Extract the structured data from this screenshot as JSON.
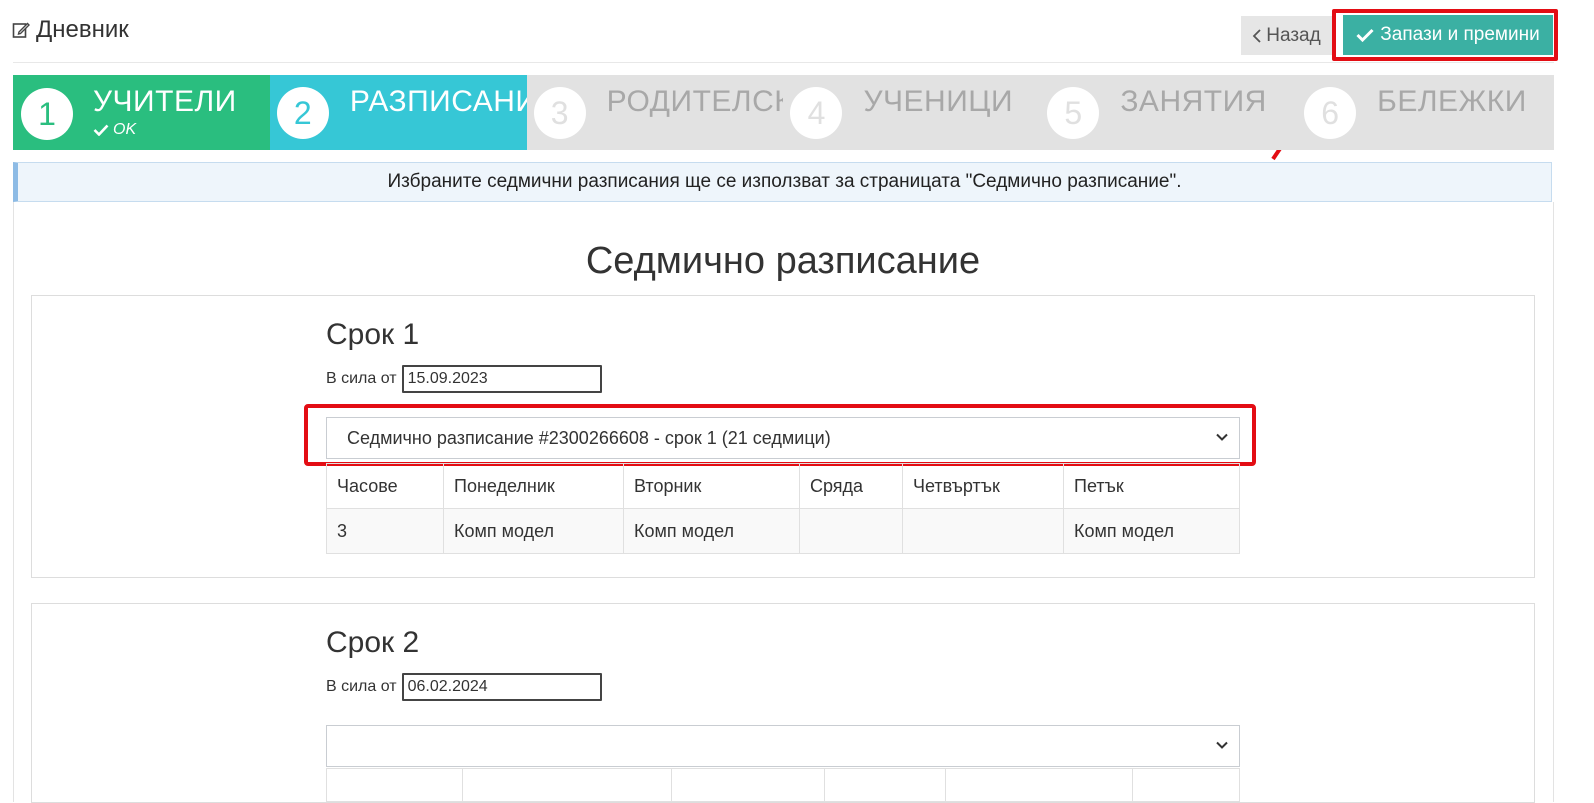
{
  "header": {
    "title": "Дневник",
    "back_label": "Назад",
    "save_label": "Запази и премини"
  },
  "steps": [
    {
      "number": "1",
      "label": "УЧИТЕЛИ",
      "sub": "OK",
      "state": "done"
    },
    {
      "number": "2",
      "label": "РАЗПИСАНИЯ",
      "state": "active"
    },
    {
      "number": "3",
      "label": "РОДИТЕЛСКИ",
      "state": "pending"
    },
    {
      "number": "4",
      "label": "УЧЕНИЦИ",
      "state": "pending"
    },
    {
      "number": "5",
      "label": "ЗАНЯТИЯ",
      "state": "pending"
    },
    {
      "number": "6",
      "label": "БЕЛЕЖКИ",
      "state": "pending"
    }
  ],
  "notice": "Избраните седмични разписания ще се използват за страницата \"Седмично разписание\".",
  "main_title": "Седмично разписание",
  "terms": [
    {
      "title": "Срок 1",
      "from_label": "В сила от",
      "from_value": "15.09.2023",
      "selected_schedule": "Седмично разписание #2300266608 - срок 1 (21 седмици)",
      "columns": [
        "Часове",
        "Понеделник",
        "Вторник",
        "Сряда",
        "Четвъртък",
        "Петък"
      ],
      "rows": [
        [
          "3",
          "Комп модел",
          "Комп модел",
          "",
          "",
          "Комп модел"
        ]
      ]
    },
    {
      "title": "Срок 2",
      "from_label": "В сила от",
      "from_value": "06.02.2024",
      "selected_schedule": ""
    }
  ],
  "colors": {
    "done_step": "#2abe7f",
    "active_step": "#36c7d6",
    "pending_step": "#e2e2e2",
    "save_button": "#3bb0a3",
    "highlight": "#e30d14"
  }
}
